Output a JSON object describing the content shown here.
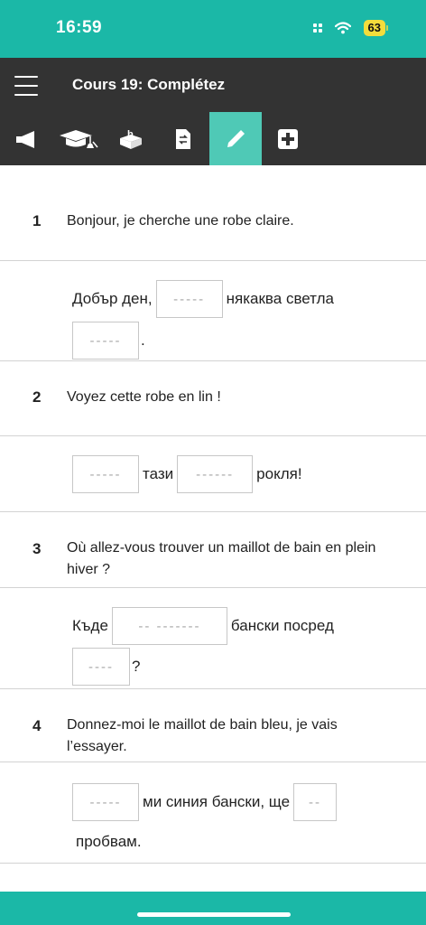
{
  "status_bar": {
    "time": "16:59",
    "battery": "63",
    "background_color": "#1bb8a7",
    "battery_color": "#f3dd3c",
    "icons": [
      "signal-icon",
      "wifi-icon",
      "battery-icon"
    ]
  },
  "header": {
    "title": "Cours 19: Complétez",
    "menu_icon": "hamburger-menu-icon",
    "background_color": "#333333"
  },
  "tabs": [
    {
      "icon": "megaphone-icon",
      "active": false
    },
    {
      "icon": "graduation-cap-icon",
      "active": false
    },
    {
      "icon": "box-icon",
      "active": false
    },
    {
      "icon": "document-icon",
      "active": false
    },
    {
      "icon": "pencil-icon",
      "active": true
    },
    {
      "icon": "plus-icon",
      "active": false
    }
  ],
  "active_tab_color": "#4fc9b6",
  "exercises": [
    {
      "number": "1",
      "question": "Bonjour, je cherche une robe claire.",
      "answer": {
        "line1_text1": "Добър ден,",
        "blank1": "-----",
        "line1_text2": "някаква светла",
        "blank2": "-----",
        "line2_text1": "."
      }
    },
    {
      "number": "2",
      "question": "Voyez cette robe en lin !",
      "answer": {
        "blank1": "-----",
        "line1_text1": "тази",
        "blank2": "------",
        "line1_text2": "рокля!"
      }
    },
    {
      "number": "3",
      "question": "Où allez-vous trouver un maillot de bain en plein hiver ?",
      "answer": {
        "line1_text1": "Къде",
        "blank1": "-- -------",
        "line1_text2": "бански посред",
        "blank2": "----",
        "line2_text1": "?"
      }
    },
    {
      "number": "4",
      "question": "Donnez-moi le maillot de bain bleu, je vais l’essayer.",
      "answer": {
        "blank1": "-----",
        "line1_text1": "ми синия бански, ще",
        "blank2": "--",
        "line2_text1": "пробвам."
      }
    }
  ]
}
